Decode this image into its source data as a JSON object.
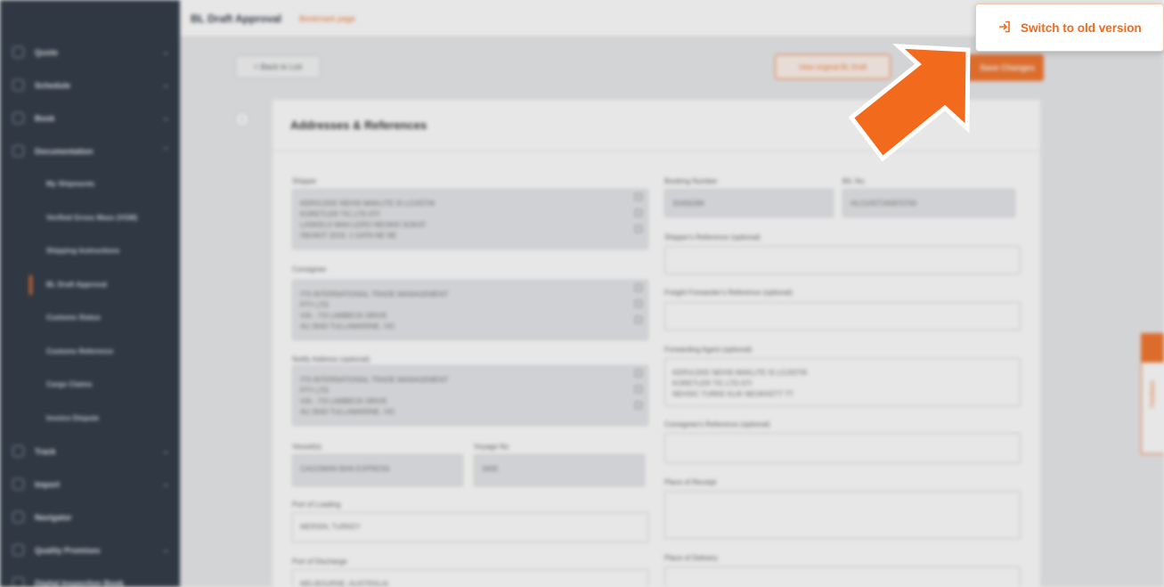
{
  "topbar": {
    "title": "BL Draft Approval",
    "bookmark": "Bookmark page"
  },
  "sidebar": {
    "items": [
      {
        "label": "Quote"
      },
      {
        "label": "Schedule"
      },
      {
        "label": "Book"
      },
      {
        "label": "Documentation"
      }
    ],
    "sub_items": [
      {
        "label": "My Shipments"
      },
      {
        "label": "Verified Gross Mass (VGM)"
      },
      {
        "label": "Shipping Instructions"
      },
      {
        "label": "BL Draft Approval"
      },
      {
        "label": "Customs Status"
      },
      {
        "label": "Customs Reference"
      },
      {
        "label": "Cargo Claims"
      },
      {
        "label": "Invoice Dispute"
      }
    ],
    "bottom_items": [
      {
        "label": "Track"
      },
      {
        "label": "Import"
      },
      {
        "label": "Navigator"
      },
      {
        "label": "Quality Promises"
      },
      {
        "label": "Digital Inspection Book"
      }
    ]
  },
  "actions": {
    "back": "< Back to List",
    "view_original": "View original BL Draft",
    "save": "Save Changes"
  },
  "card": {
    "step": "1",
    "title": "Addresses & References",
    "shipper_label": "Shipper",
    "shipper_value": "KERVLEKE NEHSI MAKLITE IS LOJISTIK\nKORETLER TIC.LTD.STI\nLASKELO MAH.LERO NEOKKI SOKAT\nISKAKIT 2016. 1 GATA NE NE",
    "consignee_label": "Consignee",
    "consignee_value": "ITS INTERNATIONAL TRADE MANAGEMENT\nPTY LTD\nVIA - 7/3 LAMBECK DRIVE\nAU 3043 TULLAMARINE, VIC",
    "notify_label": "Notify Address (optional)",
    "notify_value": "ITS INTERNATIONAL TRADE MANAGEMENT\nPTY LTD\nVIA - 7/3 LAMBECK DRIVE\nAU 3043 TULLAMARINE, VIC",
    "vessel_label": "Vessel(s)",
    "vessel_value": "CAGOWAN BAN EXPRESS",
    "voyage_label": "Voyage No",
    "voyage_value": "340E",
    "pol_label": "Port of Loading",
    "pol_value": "MERSIN, TURKEY",
    "pod_label": "Port of Discharge",
    "pod_value": "MELBOURNE, AUSTRALIA",
    "booking_label": "Booking Number",
    "booking_value": "32456289",
    "bl_label": "B/L No.",
    "bl_value": "HLCUIST240970700",
    "shipper_ref_label": "Shipper's Reference (optional)",
    "ff_ref_label": "Freight Forwarder's Reference (optional)",
    "fwd_agent_label": "Forwarding Agent (optional)",
    "fwd_agent_value": "KERVLEKE NEHSI MAKLITE IS LOJISTIK\nKORETLER TIC.LTD.STI\nNEHSIC TURKE KLIK NEOKKETT TT",
    "consignee_ref_label": "Consignee's Reference (optional)",
    "receipt_label": "Place of Receipt",
    "delivery_label": "Place of Delivery"
  },
  "feedback_label": "Feedback",
  "popup": {
    "label": "Switch to old version",
    "icon": "switch-version-icon"
  },
  "colors": {
    "accent": "#f26a1b",
    "sidebar": "#1f2a38"
  }
}
